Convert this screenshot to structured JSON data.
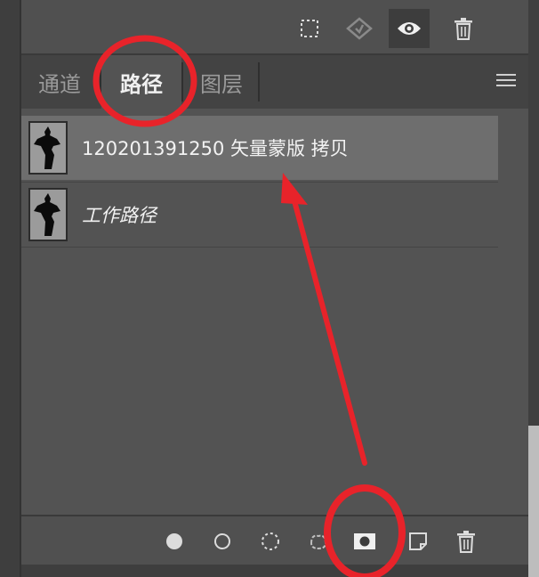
{
  "tabs": [
    {
      "label": "通道"
    },
    {
      "label": "路径"
    },
    {
      "label": "图层"
    }
  ],
  "paths": [
    {
      "name": "120201391250 矢量蒙版 拷贝"
    },
    {
      "name": "工作路径"
    }
  ],
  "top_toolbar_icons": [
    "selection-icon",
    "apply-mask-icon",
    "eye-icon",
    "trash-icon"
  ],
  "bottom_toolbar_icons": [
    "fill-path-icon",
    "stroke-path-icon",
    "load-as-selection-icon",
    "make-work-path-icon",
    "add-mask-icon",
    "new-path-icon",
    "delete-path-icon"
  ],
  "colors": {
    "annotation": "#e8232a",
    "panel": "#535353",
    "selected_row": "#6e6e6e"
  }
}
